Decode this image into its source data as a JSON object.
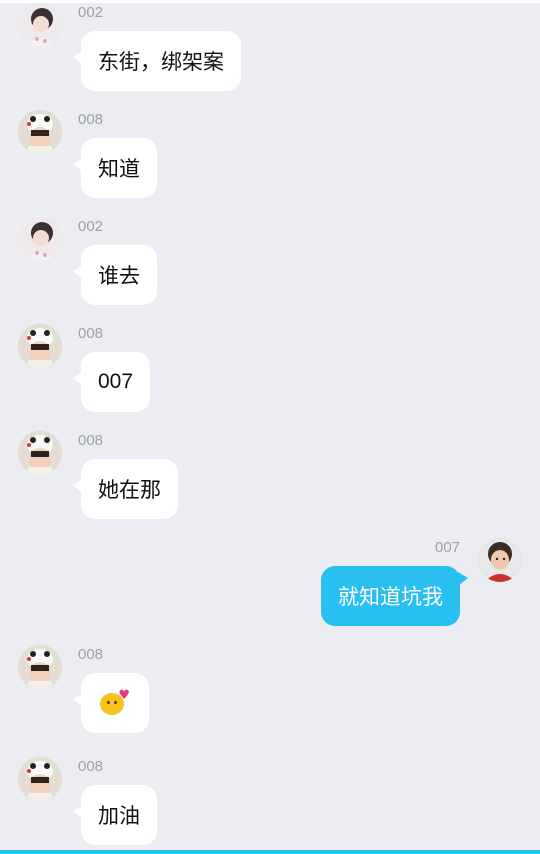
{
  "messages": [
    {
      "sender": "002",
      "text": "东街，绑架案",
      "direction": "in",
      "avatar": "avatar-girl-flower"
    },
    {
      "sender": "008",
      "text": "知道",
      "direction": "in",
      "avatar": "avatar-panda-hat"
    },
    {
      "sender": "002",
      "text": "谁去",
      "direction": "in",
      "avatar": "avatar-girl-flower"
    },
    {
      "sender": "008",
      "text": "007",
      "direction": "in",
      "avatar": "avatar-panda-hat"
    },
    {
      "sender": "008",
      "text": "她在那",
      "direction": "in",
      "avatar": "avatar-panda-hat"
    },
    {
      "sender": "007",
      "text": "就知道坑我",
      "direction": "out",
      "avatar": "avatar-child-red"
    },
    {
      "sender": "008",
      "text": "",
      "direction": "in",
      "avatar": "avatar-panda-hat",
      "sticker": "blowing-kiss-emoji"
    },
    {
      "sender": "008",
      "text": "加油",
      "direction": "in",
      "avatar": "avatar-panda-hat"
    }
  ],
  "colors": {
    "background": "#ebedf2",
    "incoming_bubble": "#ffffff",
    "outgoing_bubble": "#29bff1",
    "sender_text": "#9ea2a8",
    "accent": "#29bff1"
  }
}
